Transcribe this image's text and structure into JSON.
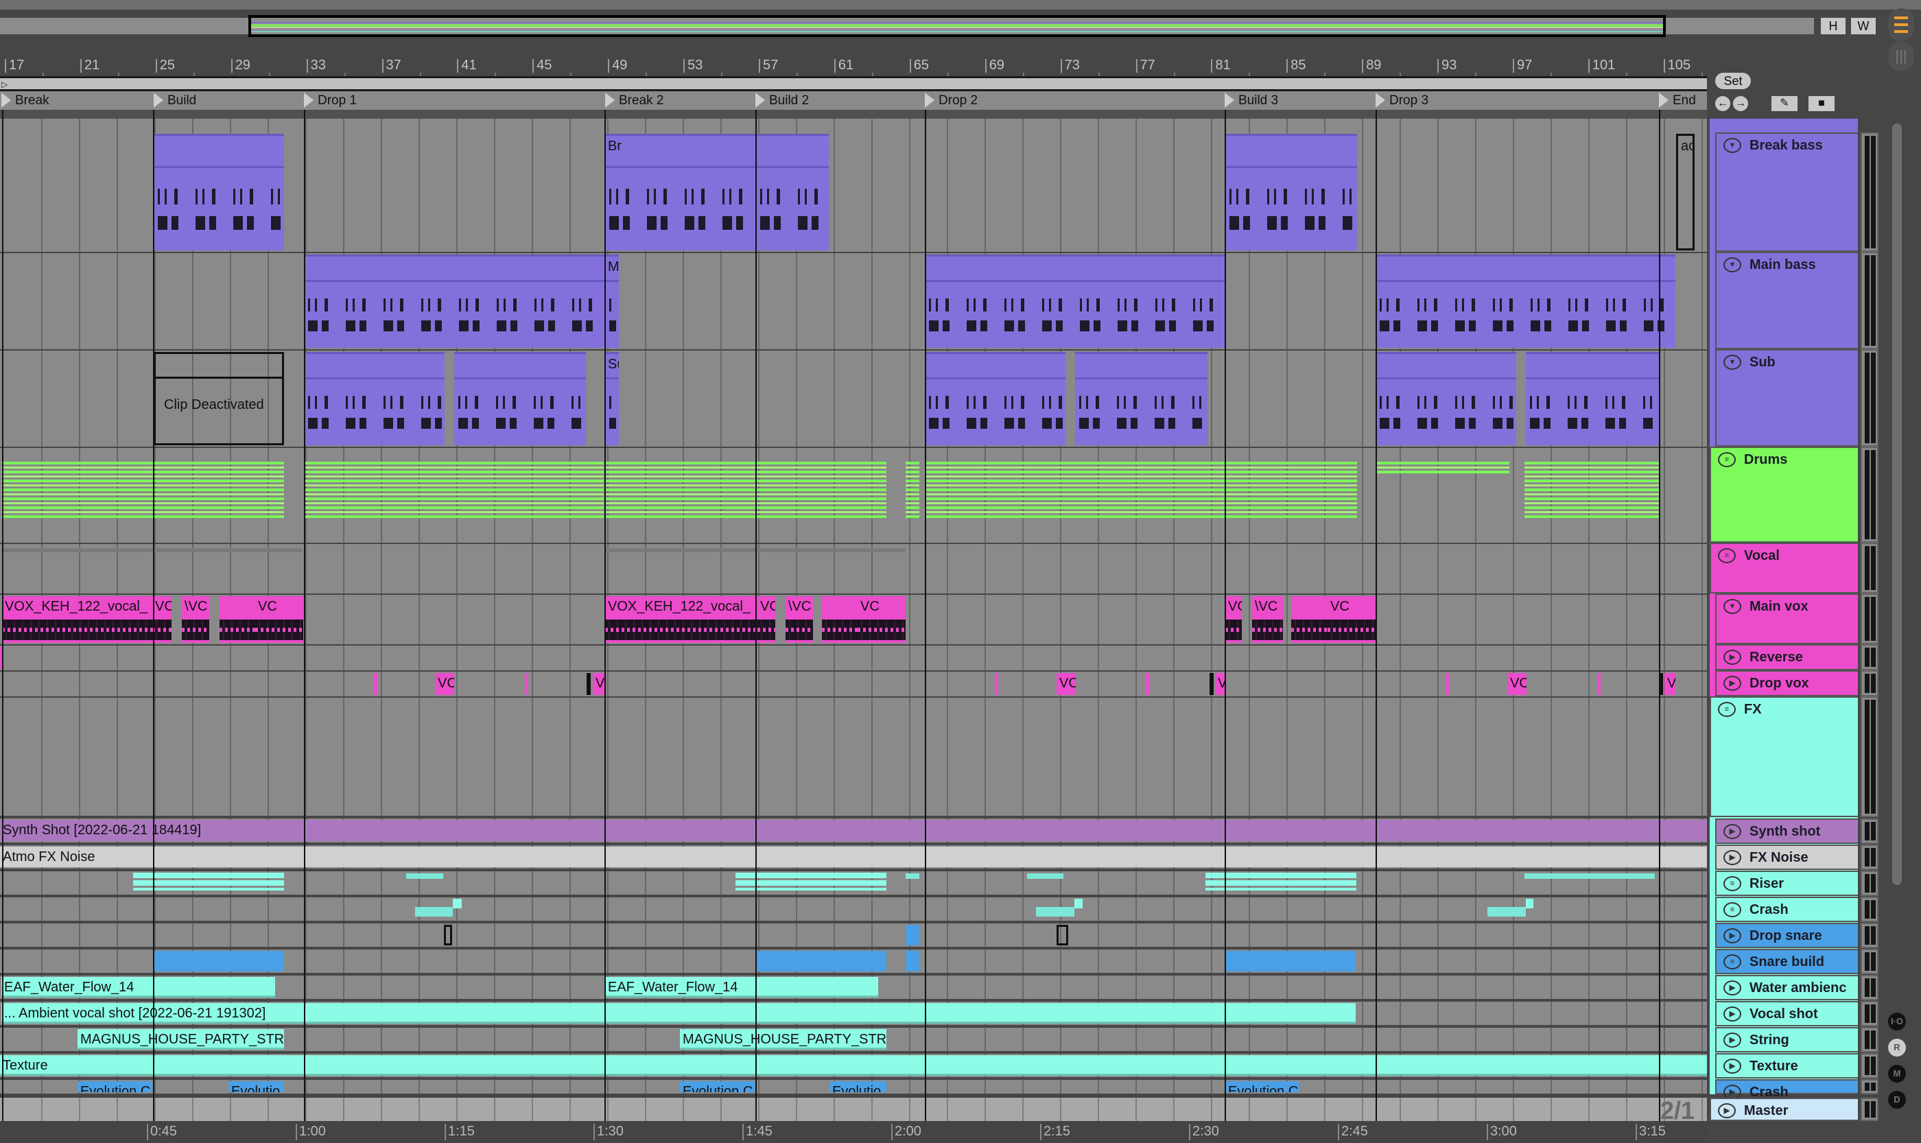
{
  "overview": {
    "h_label": "H",
    "w_label": "W"
  },
  "ruler": {
    "bars": [
      "17",
      "21",
      "25",
      "29",
      "33",
      "37",
      "41",
      "45",
      "49",
      "53",
      "57",
      "61",
      "65",
      "69",
      "73",
      "77",
      "81",
      "85",
      "89",
      "93",
      "97",
      "101",
      "105"
    ]
  },
  "locators": [
    "Break",
    "Build",
    "Drop 1",
    "Break 2",
    "Build 2",
    "Drop 2",
    "Build 3",
    "Drop 3",
    "End"
  ],
  "set_panel": {
    "set_label": "Set",
    "prev_icon": "arrow-left-icon",
    "next_icon": "arrow-right-icon",
    "draw_icon": "pencil-icon",
    "lock_icon": "lock-icon"
  },
  "tracks": [
    {
      "name": "Break bass",
      "color": "#8470db",
      "icon": "fold-down"
    },
    {
      "name": "Main bass",
      "color": "#8470db",
      "icon": "fold-down"
    },
    {
      "name": "Sub",
      "color": "#8470db",
      "icon": "fold-down"
    },
    {
      "name": "Drums",
      "color": "#7cfb5a",
      "icon": "group"
    },
    {
      "name": "Vocal",
      "color": "#ec4bcc",
      "icon": "group"
    },
    {
      "name": "Main vox",
      "color": "#ec4bcc",
      "icon": "fold-down"
    },
    {
      "name": "Reverse",
      "color": "#ec4bcc",
      "icon": "play"
    },
    {
      "name": "Drop vox",
      "color": "#ec4bcc",
      "icon": "play"
    },
    {
      "name": "FX",
      "color": "#8cfce6",
      "icon": "group"
    },
    {
      "name": "Synth shot",
      "color": "#ab78c0",
      "icon": "play"
    },
    {
      "name": "FX Noise",
      "color": "#d0d0d0",
      "icon": "play"
    },
    {
      "name": "Riser",
      "color": "#8cfce6",
      "icon": "group"
    },
    {
      "name": "Crash",
      "color": "#8cfce6",
      "icon": "group"
    },
    {
      "name": "Drop snare",
      "color": "#4aa0e6",
      "icon": "play"
    },
    {
      "name": "Snare build",
      "color": "#4aa0e6",
      "icon": "group"
    },
    {
      "name": "Water ambienc",
      "color": "#8cfce6",
      "icon": "play"
    },
    {
      "name": "Vocal shot",
      "color": "#8cfce6",
      "icon": "play"
    },
    {
      "name": "String",
      "color": "#8cfce6",
      "icon": "play"
    },
    {
      "name": "Texture",
      "color": "#8cfce6",
      "icon": "play"
    },
    {
      "name": "Crash",
      "color": "#4aa0e6",
      "icon": "play"
    },
    {
      "name": "Master",
      "color": "#cbe7f8",
      "icon": "play"
    }
  ],
  "clips": {
    "break_bass_short_1": "Br",
    "break_bass_end": "ac",
    "main_bass_short": "M",
    "sub_short": "Su",
    "sub_deactivated": "Clip Deactivated",
    "vox_main": "VOX_KEH_122_vocal_",
    "vox_short_a": "VC",
    "vox_short_b": "\\VC",
    "vox_short_c": "V",
    "synth_shot": "Synth Shot [2022-06-21 184419]",
    "fx_noise": "Atmo FX Noise",
    "water": "EAF_Water_Flow_14",
    "vocal_shot": "... Ambient vocal shot [2022-06-21 191302]",
    "string": "MAGNUS_HOUSE_PARTY_STRI",
    "texture": "Texture",
    "evolution_a": "Evolution C",
    "evolution_b": "Evolutio"
  },
  "time_ruler": [
    "0:45",
    "1:00",
    "1:15",
    "1:30",
    "1:45",
    "2:00",
    "2:15",
    "2:30",
    "2:45",
    "3:00",
    "3:15"
  ],
  "zoom_ratio": "2/1",
  "side_controls": [
    "I·O",
    "R",
    "M",
    "D"
  ]
}
